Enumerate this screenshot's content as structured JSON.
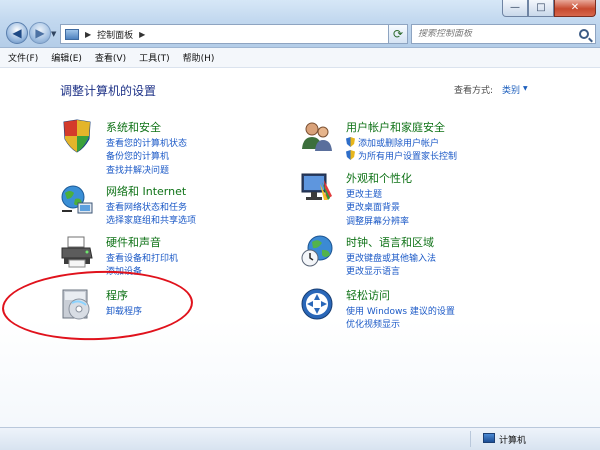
{
  "window": {
    "controls": {
      "minimize": "—",
      "maximize": "□",
      "close": "✕"
    }
  },
  "toolbar": {
    "back_glyph": "◀",
    "forward_glyph": "▶",
    "dropdown_glyph": "▼",
    "address_path": [
      "控制面板"
    ],
    "address_sep": "▶",
    "refresh_glyph": "⟳",
    "search_placeholder": "搜索控制面板"
  },
  "menu": [
    "文件(F)",
    "编辑(E)",
    "查看(V)",
    "工具(T)",
    "帮助(H)"
  ],
  "main": {
    "title": "调整计算机的设置",
    "view_label": "查看方式:",
    "view_value": "类别",
    "view_drop": "▼"
  },
  "categories": {
    "system": {
      "title": "系统和安全",
      "links": [
        "查看您的计算机状态",
        "备份您的计算机",
        "查找并解决问题"
      ]
    },
    "network": {
      "title": "网络和 Internet",
      "links": [
        "查看网络状态和任务",
        "选择家庭组和共享选项"
      ]
    },
    "hardware": {
      "title": "硬件和声音",
      "links": [
        "查看设备和打印机",
        "添加设备"
      ]
    },
    "programs": {
      "title": "程序",
      "links": [
        "卸载程序"
      ]
    },
    "users": {
      "title": "用户帐户和家庭安全",
      "links": [
        "添加或删除用户帐户",
        "为所有用户设置家长控制"
      ]
    },
    "appearance": {
      "title": "外观和个性化",
      "links": [
        "更改主题",
        "更改桌面背景",
        "调整屏幕分辨率"
      ]
    },
    "clock": {
      "title": "时钟、语言和区域",
      "links": [
        "更改键盘或其他输入法",
        "更改显示语言"
      ]
    },
    "ease": {
      "title": "轻松访问",
      "links": [
        "使用 Windows 建议的设置",
        "优化视频显示"
      ]
    }
  },
  "status": {
    "computer_label": "计算机"
  },
  "colors": {
    "title_green": "#0e7216",
    "link_blue": "#1c5ac7",
    "heading_blue": "#1e3287",
    "annotation_red": "#e0121c"
  }
}
